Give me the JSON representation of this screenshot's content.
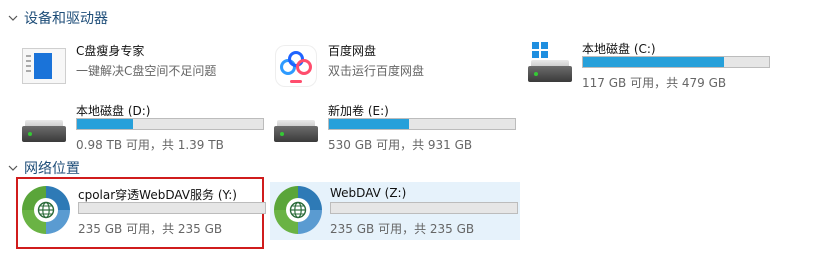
{
  "groups": [
    {
      "label": "设备和驱动器",
      "tiles": [
        {
          "title": "C盘瘦身专家",
          "sub": "一键解决C盘空间不足问题",
          "icon": "c-disk-slim-icon"
        },
        {
          "title": "百度网盘",
          "sub": "双击运行百度网盘",
          "icon": "baidu-netdisk-icon"
        },
        {
          "title": "本地磁盘 (C:)",
          "sub": "117 GB 可用，共 479 GB",
          "used_fraction": 0.76,
          "icon": "drive-icon"
        },
        {
          "title": "本地磁盘 (D:)",
          "sub": "0.98 TB 可用，共 1.39 TB",
          "used_fraction": 0.3,
          "icon": "drive-icon"
        },
        {
          "title": "新加卷 (E:)",
          "sub": "530 GB 可用，共 931 GB",
          "used_fraction": 0.43,
          "icon": "drive-icon"
        }
      ]
    },
    {
      "label": "网络位置",
      "tiles": [
        {
          "title": "cpolar穿透WebDAV服务 (Y:)",
          "sub": "235 GB 可用，共 235 GB",
          "used_fraction": 0.0,
          "icon": "network-globe-icon"
        },
        {
          "title": "WebDAV (Z:)",
          "sub": "235 GB 可用，共 235 GB",
          "used_fraction": 0.0,
          "icon": "network-globe-icon"
        }
      ]
    }
  ],
  "colors": {
    "group_header": "#1f4e79",
    "bar_fill": "#26a0da",
    "selection_border": "#d01c1c",
    "hover_bg": "#e6f2fb"
  }
}
